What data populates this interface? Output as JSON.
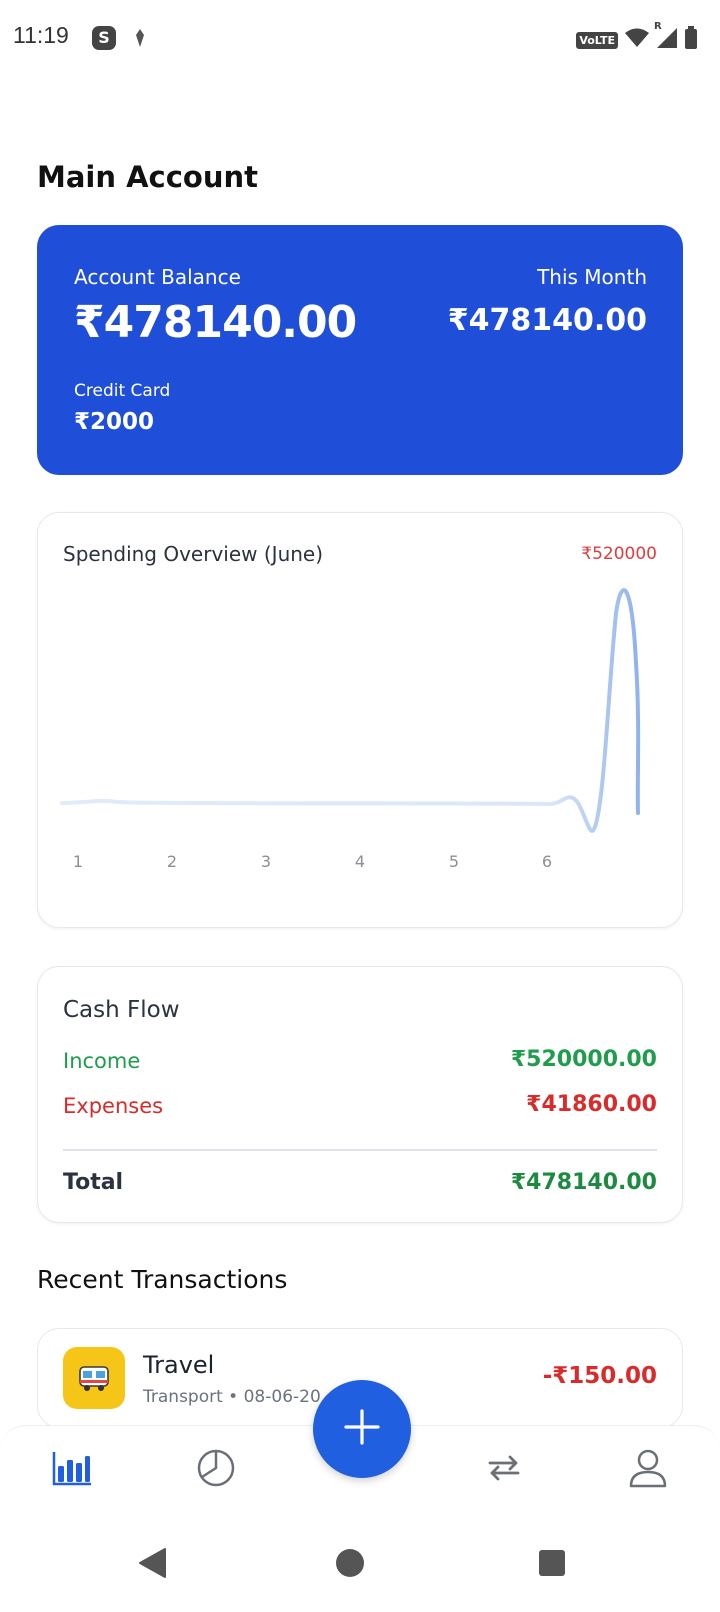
{
  "status_bar": {
    "time": "11:19",
    "s_icon_letter": "S",
    "volte": "VoLTE",
    "roaming_indicator": "R"
  },
  "page_title": "Main Account",
  "balance_card": {
    "account_balance_label": "Account Balance",
    "account_balance_value": "₹478140.00",
    "this_month_label": "This Month",
    "this_month_value": "₹478140.00",
    "credit_card_label": "Credit Card",
    "credit_card_value": "₹2000",
    "background_color": "#1f4fd8"
  },
  "spending_overview": {
    "title": "Spending Overview (June)",
    "max_label": "₹520000",
    "x_tick_labels": [
      "1",
      "2",
      "3",
      "4",
      "5",
      "6"
    ],
    "line_color": "#a9c6f2"
  },
  "cash_flow": {
    "title": "Cash Flow",
    "income_label": "Income",
    "income_value": "₹520000.00",
    "expenses_label": "Expenses",
    "expenses_value": "₹41860.00",
    "total_label": "Total",
    "total_value": "₹478140.00"
  },
  "recent_transactions": {
    "title": "Recent Transactions",
    "items": [
      {
        "name": "Travel",
        "meta": "Transport • 08-06-20",
        "amount": "-₹150.00",
        "icon": "bus-icon",
        "icon_bg": "#f5c518"
      }
    ]
  },
  "bottom_nav": {
    "items": [
      {
        "icon": "bar-chart-icon",
        "active": true
      },
      {
        "icon": "pie-chart-icon",
        "active": false
      },
      {
        "icon": "add-icon",
        "active": false
      },
      {
        "icon": "transfer-icon",
        "active": false
      },
      {
        "icon": "profile-icon",
        "active": false
      }
    ],
    "accent_color": "#1f5fe0"
  },
  "system_nav": {
    "items": [
      "back-icon",
      "home-icon",
      "recents-icon"
    ]
  }
}
